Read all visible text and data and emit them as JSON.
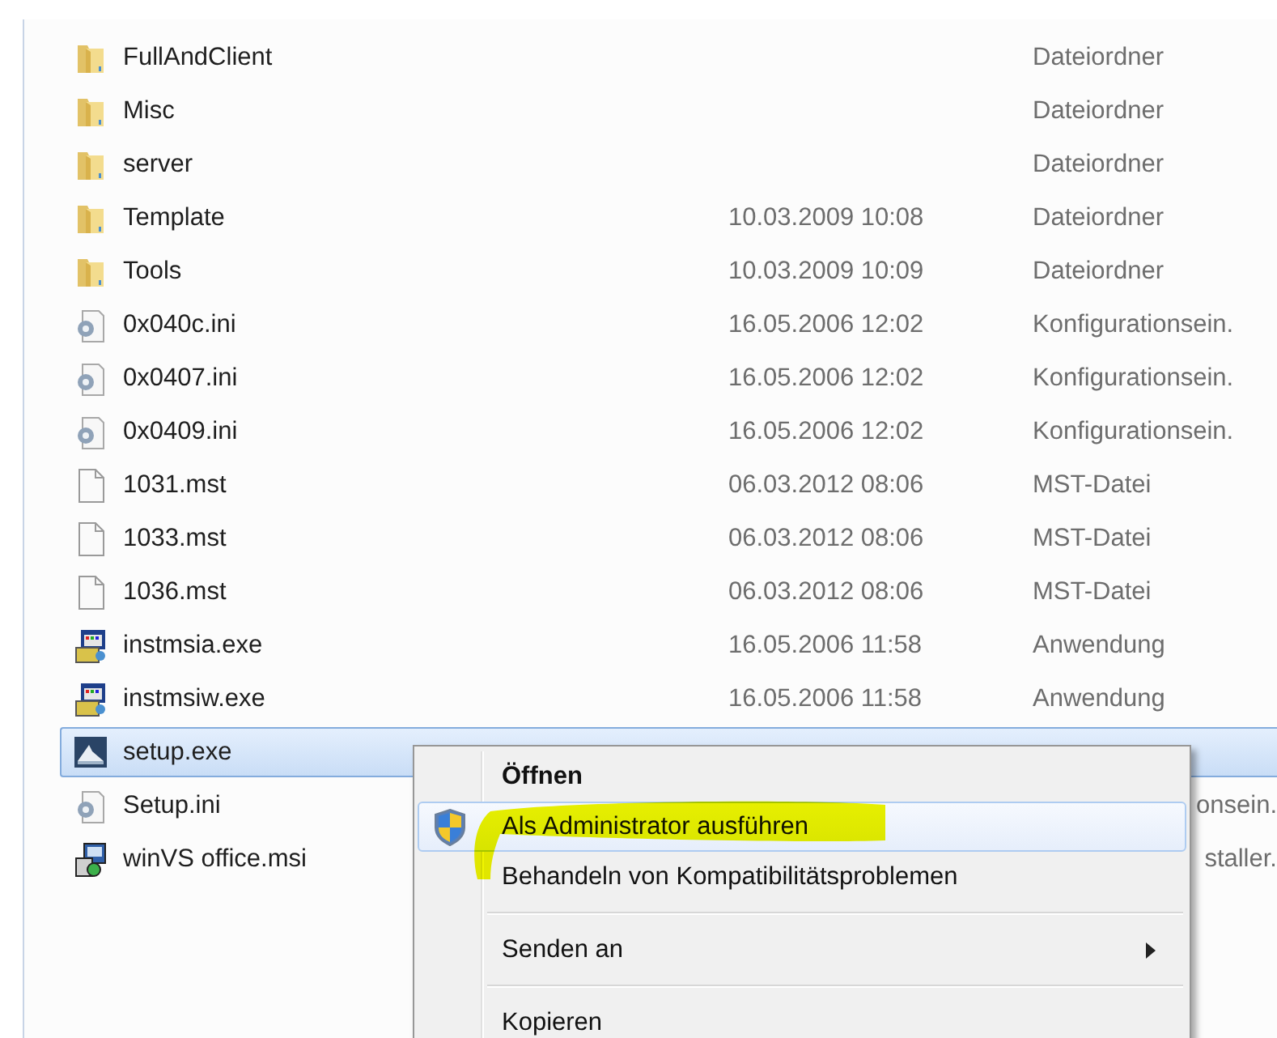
{
  "files": [
    {
      "name": "FullAndClient",
      "type": "Dateiordner",
      "kind": "folder",
      "selected": false
    },
    {
      "name": "Misc",
      "type": "Dateiordner",
      "kind": "folder",
      "selected": false
    },
    {
      "name": "server",
      "type": "Dateiordner",
      "kind": "folder",
      "selected": false
    },
    {
      "name": "Template",
      "date": "10.03.2009 10:08",
      "type": "Dateiordner",
      "kind": "folder",
      "selected": false
    },
    {
      "name": "Tools",
      "date": "10.03.2009 10:09",
      "type": "Dateiordner",
      "kind": "folder",
      "selected": false
    },
    {
      "name": "0x040c.ini",
      "date": "16.05.2006 12:02",
      "type": "Konfigurationsein.",
      "kind": "settings",
      "selected": false
    },
    {
      "name": "0x0407.ini",
      "date": "16.05.2006 12:02",
      "type": "Konfigurationsein.",
      "kind": "settings",
      "selected": false
    },
    {
      "name": "0x0409.ini",
      "date": "16.05.2006 12:02",
      "type": "Konfigurationsein.",
      "kind": "settings",
      "selected": false
    },
    {
      "name": "1031.mst",
      "date": "06.03.2012 08:06",
      "type": "MST-Datei",
      "kind": "document",
      "selected": false
    },
    {
      "name": "1033.mst",
      "date": "06.03.2012 08:06",
      "type": "MST-Datei",
      "kind": "document",
      "selected": false
    },
    {
      "name": "1036.mst",
      "date": "06.03.2012 08:06",
      "type": "MST-Datei",
      "kind": "document",
      "selected": false
    },
    {
      "name": "instmsia.exe",
      "date": "16.05.2006 11:58",
      "type": "Anwendung",
      "kind": "application",
      "selected": false
    },
    {
      "name": "instmsiw.exe",
      "date": "16.05.2006 11:58",
      "type": "Anwendung",
      "kind": "application",
      "selected": false
    },
    {
      "name": "setup.exe",
      "kind": "setup",
      "selected": true
    },
    {
      "name": "Setup.ini",
      "type": "onsein.",
      "type_clipped": true,
      "kind": "settings",
      "selected": false
    },
    {
      "name": "winVS office.msi",
      "type": "staller.",
      "type_clipped": true,
      "kind": "package",
      "selected": false
    }
  ],
  "context_menu": {
    "items": [
      {
        "label": "Öffnen",
        "bold": true,
        "selected": false
      },
      {
        "label": "Als Administrator ausführen",
        "shield": true,
        "highlighted_marker": true,
        "selected": true
      },
      {
        "label": "Behandeln von Kompatibilitätsproblemen",
        "selected": false,
        "separator_after": true
      },
      {
        "label": "Senden an",
        "submenu": true,
        "selected": false,
        "separator_after": true
      },
      {
        "label": "Kopieren",
        "selected": false
      }
    ]
  }
}
